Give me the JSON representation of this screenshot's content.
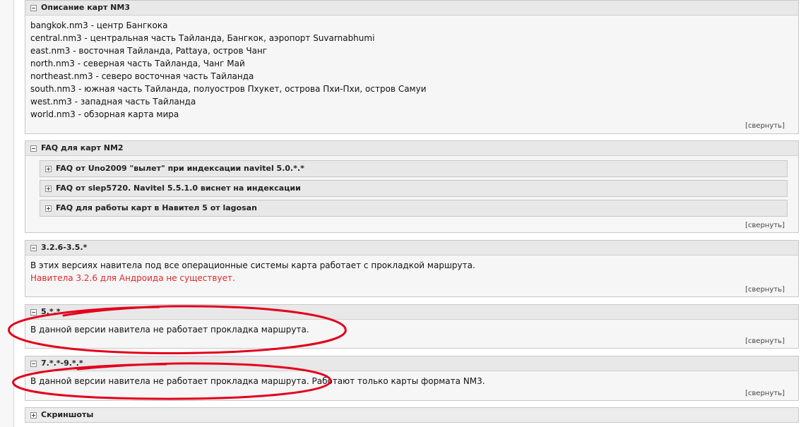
{
  "collapse_label": "[свернуть]",
  "sections": {
    "maps": {
      "title": "Описание карт NM3",
      "lines": [
        "bangkok.nm3 - центр Бангкока",
        "central.nm3 - центральная часть Тайланда, Бангкок, аэропорт Suvarnabhumi",
        "east.nm3 - восточная Тайланда, Pattaya, остров Чанг",
        "north.nm3 - северная часть Тайланда, Чанг Май",
        "northeast.nm3 - северо восточная часть Тайланда",
        "south.nm3 - южная часть Тайланда, полуостров Пхукет, острова Пхи-Пхи, остров Самуи",
        "west.nm3 - западная часть Тайланда",
        "world.nm3 - обзорная карта мира"
      ]
    },
    "faq": {
      "title": "FAQ для карт NM2",
      "items": [
        "FAQ от Uno2009 \"вылет\" при индексации navitel 5.0.*.*",
        "FAQ от slep5720. Navitel 5.5.1.0 виснет на индексации",
        "FAQ для работы карт в Навител 5 от lagosan"
      ]
    },
    "v326": {
      "title": "3.2.6-3.5.*",
      "line1": "В этих версиях навитела под все операционные системы карта работает с прокладкой маршрута.",
      "line2": "Навитела 3.2.6 для Андроида не существует."
    },
    "v5": {
      "title": "5.*.*",
      "line1": "В данной версии навитела не работает прокладка маршрута."
    },
    "v7": {
      "title": "7.*.*-9.*.*",
      "line1": "В данной версии навитела не работает прокладка маршрута. Работают только карты формата NM3."
    },
    "screens": {
      "title": "Скриншоты"
    }
  },
  "colors": {
    "warning_text": "#e0272c",
    "annotation": "#e3001b"
  }
}
